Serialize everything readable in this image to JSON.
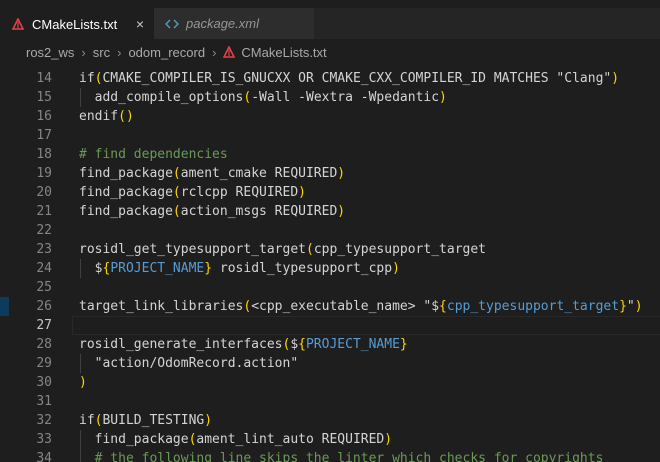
{
  "tabs": [
    {
      "label": "CMakeLists.txt",
      "icon": "cmake-icon",
      "active": true,
      "close": "×"
    },
    {
      "label": "package.xml",
      "icon": "xml-code-icon",
      "active": false
    }
  ],
  "breadcrumb": {
    "items": [
      "ros2_ws",
      "src",
      "odom_record",
      "CMakeLists.txt"
    ],
    "separator": "›"
  },
  "colors": {
    "cmake_icon": "#e5414b",
    "xml_icon": "#519aba",
    "paren": "#ffd700",
    "variable": "#569cd6",
    "comment": "#6a9955",
    "text": "#d4d4d4"
  },
  "editor": {
    "current_line": "27",
    "lines": [
      {
        "n": "14",
        "parts": [
          [
            "fn",
            "if"
          ],
          [
            "paren",
            "("
          ],
          [
            "t",
            "CMAKE_COMPILER_IS_GNUCXX OR CMAKE_CXX_COMPILER_ID MATCHES \"Clang\""
          ],
          [
            "paren",
            ")"
          ]
        ]
      },
      {
        "n": "15",
        "guide": true,
        "parts": [
          [
            "t",
            "  add_compile_options"
          ],
          [
            "paren",
            "("
          ],
          [
            "t",
            "-Wall -Wextra -Wpedantic"
          ],
          [
            "paren",
            ")"
          ]
        ]
      },
      {
        "n": "16",
        "parts": [
          [
            "fn",
            "endif"
          ],
          [
            "paren",
            "()"
          ]
        ]
      },
      {
        "n": "17",
        "parts": []
      },
      {
        "n": "18",
        "parts": [
          [
            "cmt",
            "# find dependencies"
          ]
        ]
      },
      {
        "n": "19",
        "parts": [
          [
            "fn",
            "find_package"
          ],
          [
            "paren",
            "("
          ],
          [
            "t",
            "ament_cmake REQUIRED"
          ],
          [
            "paren",
            ")"
          ]
        ]
      },
      {
        "n": "20",
        "parts": [
          [
            "fn",
            "find_package"
          ],
          [
            "paren",
            "("
          ],
          [
            "t",
            "rclcpp REQUIRED"
          ],
          [
            "paren",
            ")"
          ]
        ]
      },
      {
        "n": "21",
        "parts": [
          [
            "fn",
            "find_package"
          ],
          [
            "paren",
            "("
          ],
          [
            "t",
            "action_msgs REQUIRED"
          ],
          [
            "paren",
            ")"
          ]
        ]
      },
      {
        "n": "22",
        "parts": []
      },
      {
        "n": "23",
        "parts": [
          [
            "fn",
            "rosidl_get_typesupport_target"
          ],
          [
            "paren",
            "("
          ],
          [
            "t",
            "cpp_typesupport_target"
          ]
        ]
      },
      {
        "n": "24",
        "guide": true,
        "parts": [
          [
            "t",
            "  $"
          ],
          [
            "paren",
            "{"
          ],
          [
            "var",
            "PROJECT_NAME"
          ],
          [
            "paren",
            "}"
          ],
          [
            "t",
            " rosidl_typesupport_cpp"
          ],
          [
            "paren",
            ")"
          ]
        ]
      },
      {
        "n": "25",
        "parts": []
      },
      {
        "n": "26",
        "marker": true,
        "parts": [
          [
            "fn",
            "target_link_libraries"
          ],
          [
            "paren",
            "("
          ],
          [
            "t",
            "<cpp_executable_name> \"$"
          ],
          [
            "paren",
            "{"
          ],
          [
            "var",
            "cpp_typesupport_target"
          ],
          [
            "paren",
            "}"
          ],
          [
            "t",
            "\""
          ],
          [
            "paren",
            ")"
          ]
        ]
      },
      {
        "n": "27",
        "current": true,
        "parts": []
      },
      {
        "n": "28",
        "parts": [
          [
            "fn",
            "rosidl_generate_interfaces"
          ],
          [
            "paren",
            "("
          ],
          [
            "t",
            "$"
          ],
          [
            "paren",
            "{"
          ],
          [
            "var",
            "PROJECT_NAME"
          ],
          [
            "paren",
            "}"
          ]
        ]
      },
      {
        "n": "29",
        "guide": true,
        "parts": [
          [
            "t",
            "  \"action/OdomRecord.action\""
          ]
        ]
      },
      {
        "n": "30",
        "parts": [
          [
            "paren",
            ")"
          ]
        ]
      },
      {
        "n": "31",
        "parts": []
      },
      {
        "n": "32",
        "parts": [
          [
            "fn",
            "if"
          ],
          [
            "paren",
            "("
          ],
          [
            "t",
            "BUILD_TESTING"
          ],
          [
            "paren",
            ")"
          ]
        ]
      },
      {
        "n": "33",
        "guide": true,
        "parts": [
          [
            "t",
            "  find_package"
          ],
          [
            "paren",
            "("
          ],
          [
            "t",
            "ament_lint_auto REQUIRED"
          ],
          [
            "paren",
            ")"
          ]
        ]
      },
      {
        "n": "34",
        "guide": true,
        "parts": [
          [
            "t",
            "  "
          ],
          [
            "cmt",
            "# the following line skips the linter which checks for copyrights"
          ]
        ]
      }
    ]
  }
}
